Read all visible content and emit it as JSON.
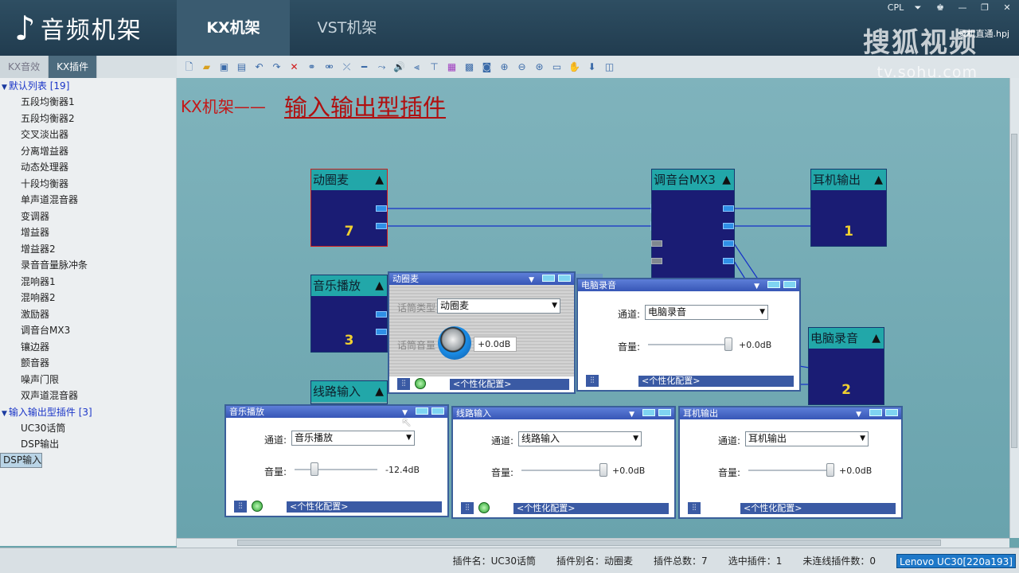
{
  "header": {
    "logo": "音频机架",
    "tabs": [
      "KX机架",
      "VST机架"
    ],
    "window_controls": [
      "CPL",
      "⏷",
      "♚",
      "—",
      "❐",
      "✕"
    ],
    "file": "录机直通.hpj",
    "watermark": "搜狐视频",
    "watermark_url": "tv.sohu.com"
  },
  "subtabs": [
    "KX音效",
    "KX插件"
  ],
  "sidebar": {
    "group1": "默认列表 [19]",
    "items1": [
      "五段均衡器1",
      "五段均衡器2",
      "交叉淡出器",
      "分离增益器",
      "动态处理器",
      "十段均衡器",
      "单声道混音器",
      "变调器",
      "增益器",
      "增益器2",
      "录音音量脉冲条",
      "混响器1",
      "混响器2",
      "激励器",
      "调音台MX3",
      "镶边器",
      "颤音器",
      "噪声门限",
      "双声道混音器"
    ],
    "group2": "输入输出型插件 [3]",
    "items2": [
      "UC30话筒",
      "DSP输出",
      "DSP输入"
    ]
  },
  "canvas": {
    "title_pre": "KX机架——",
    "title_main": "输入输出型插件",
    "nodes": {
      "mic": {
        "title": "动圈麦",
        "num": "7"
      },
      "mixer": {
        "title": "调音台MX3"
      },
      "headphone": {
        "title": "耳机输出",
        "num": "1"
      },
      "music": {
        "title": "音乐播放",
        "num": "3"
      },
      "pcrec": {
        "title": "电脑录音",
        "num": "2"
      },
      "line": {
        "title": "线路输入"
      }
    }
  },
  "dialogs": {
    "mic": {
      "title": "动圈麦",
      "type_label": "话筒类型",
      "type_value": "动圈麦",
      "vol_label": "话筒音量",
      "vol_value": "+0.0dB",
      "cfg": "<个性化配置>"
    },
    "pcrec": {
      "title": "电脑录音",
      "ch_label": "通道:",
      "ch_value": "电脑录音",
      "vol_label": "音量:",
      "vol_value": "+0.0dB",
      "cfg": "<个性化配置>"
    },
    "music": {
      "title": "音乐播放",
      "ch_label": "通道:",
      "ch_value": "音乐播放",
      "vol_label": "音量:",
      "vol_value": "-12.4dB",
      "cfg": "<个性化配置>"
    },
    "line": {
      "title": "线路输入",
      "ch_label": "通道:",
      "ch_value": "线路输入",
      "vol_label": "音量:",
      "vol_value": "+0.0dB",
      "cfg": "<个性化配置>"
    },
    "headphone": {
      "title": "耳机输出",
      "ch_label": "通道:",
      "ch_value": "耳机输出",
      "vol_label": "音量:",
      "vol_value": "+0.0dB",
      "cfg": "<个性化配置>"
    }
  },
  "status": {
    "plugin": "插件名：UC30话筒",
    "alias": "插件别名：动圈麦",
    "total": "插件总数：7",
    "selected": "选中插件：1",
    "unconnected": "未连线插件数：0",
    "device": "Lenovo UC30[220a193]"
  }
}
